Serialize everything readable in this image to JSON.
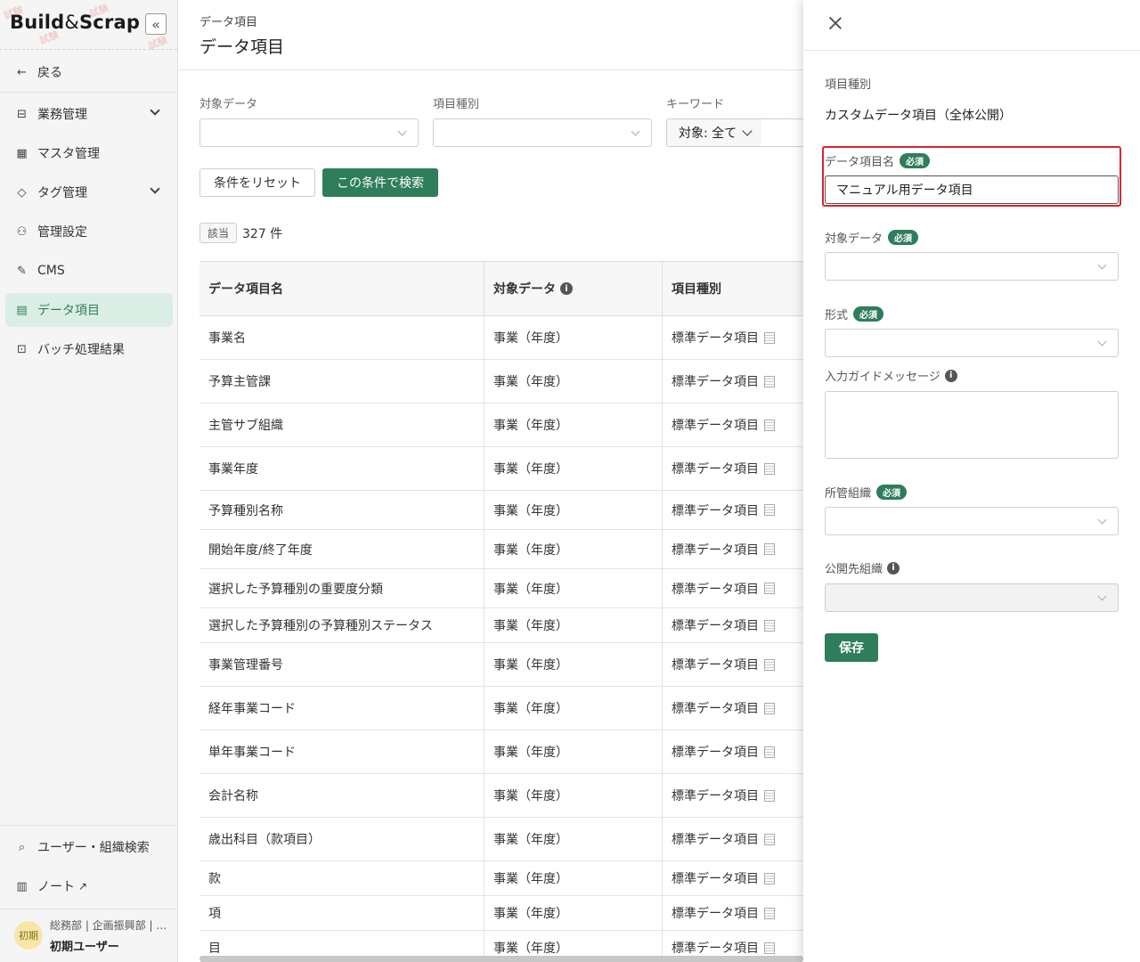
{
  "sidebar": {
    "brand": {
      "part1": "Build",
      "amp": "&",
      "part2": "Scrap",
      "watermark": "試験"
    },
    "collapse_icon": "«",
    "back_label": "戻る",
    "items": [
      {
        "label": "業務管理",
        "icon": "form-icon",
        "has_chevron": true
      },
      {
        "label": "マスタ管理",
        "icon": "grid-icon",
        "has_chevron": false
      },
      {
        "label": "タグ管理",
        "icon": "tag-icon",
        "has_chevron": true
      },
      {
        "label": "管理設定",
        "icon": "user-settings-icon",
        "has_chevron": false
      },
      {
        "label": "CMS",
        "icon": "edit-icon",
        "has_chevron": false
      },
      {
        "label": "データ項目",
        "icon": "data-item-icon",
        "has_chevron": false,
        "active": true
      },
      {
        "label": "バッチ処理結果",
        "icon": "terminal-icon",
        "has_chevron": false
      }
    ],
    "user_search_label": "ユーザー・組織検索",
    "note_label": "ノート",
    "user": {
      "avatar": "初期",
      "dept": "総務部 | 企画振興部 | …",
      "name": "初期ユーザー"
    }
  },
  "main": {
    "breadcrumb": "データ項目",
    "title": "データ項目",
    "filters": {
      "target_label": "対象データ",
      "type_label": "項目種別",
      "keyword_label": "キーワード",
      "scope_value": "対象: 全て"
    },
    "reset_label": "条件をリセット",
    "search_label": "この条件で検索",
    "count_badge": "該当",
    "count_text": "327 件",
    "table": {
      "headers": [
        "データ項目名",
        "対象データ",
        "項目種別"
      ],
      "rows": [
        [
          "事業名",
          "事業（年度）",
          "標準データ項目"
        ],
        [
          "予算主管課",
          "事業（年度）",
          "標準データ項目"
        ],
        [
          "主管サブ組織",
          "事業（年度）",
          "標準データ項目"
        ],
        [
          "事業年度",
          "事業（年度）",
          "標準データ項目"
        ],
        [
          "予算種別名称",
          "事業（年度）",
          "標準データ項目"
        ],
        [
          "開始年度/終了年度",
          "事業（年度）",
          "標準データ項目"
        ],
        [
          "選択した予算種別の重要度分類",
          "事業（年度）",
          "標準データ項目"
        ],
        [
          "選択した予算種別の予算種別ステータス",
          "事業（年度）",
          "標準データ項目"
        ],
        [
          "事業管理番号",
          "事業（年度）",
          "標準データ項目"
        ],
        [
          "経年事業コード",
          "事業（年度）",
          "標準データ項目"
        ],
        [
          "単年事業コード",
          "事業（年度）",
          "標準データ項目"
        ],
        [
          "会計名称",
          "事業（年度）",
          "標準データ項目"
        ],
        [
          "歳出科目（款項目）",
          "事業（年度）",
          "標準データ項目"
        ],
        [
          "款",
          "事業（年度）",
          "標準データ項目"
        ],
        [
          "項",
          "事業（年度）",
          "標準データ項目"
        ],
        [
          "目",
          "事業（年度）",
          "標準データ項目"
        ]
      ]
    }
  },
  "drawer": {
    "type_label": "項目種別",
    "type_value": "カスタムデータ項目（全体公開）",
    "name_label": "データ項目名",
    "name_value": "マニュアル用データ項目",
    "required": "必須",
    "target_label": "対象データ",
    "format_label": "形式",
    "guide_label": "入力ガイドメッセージ",
    "org_label": "所管組織",
    "public_org_label": "公開先組織",
    "save_label": "保存"
  },
  "colors": {
    "accent": "#2e7d5b",
    "highlight": "#d9262c",
    "active_bg": "#dbeee5"
  }
}
